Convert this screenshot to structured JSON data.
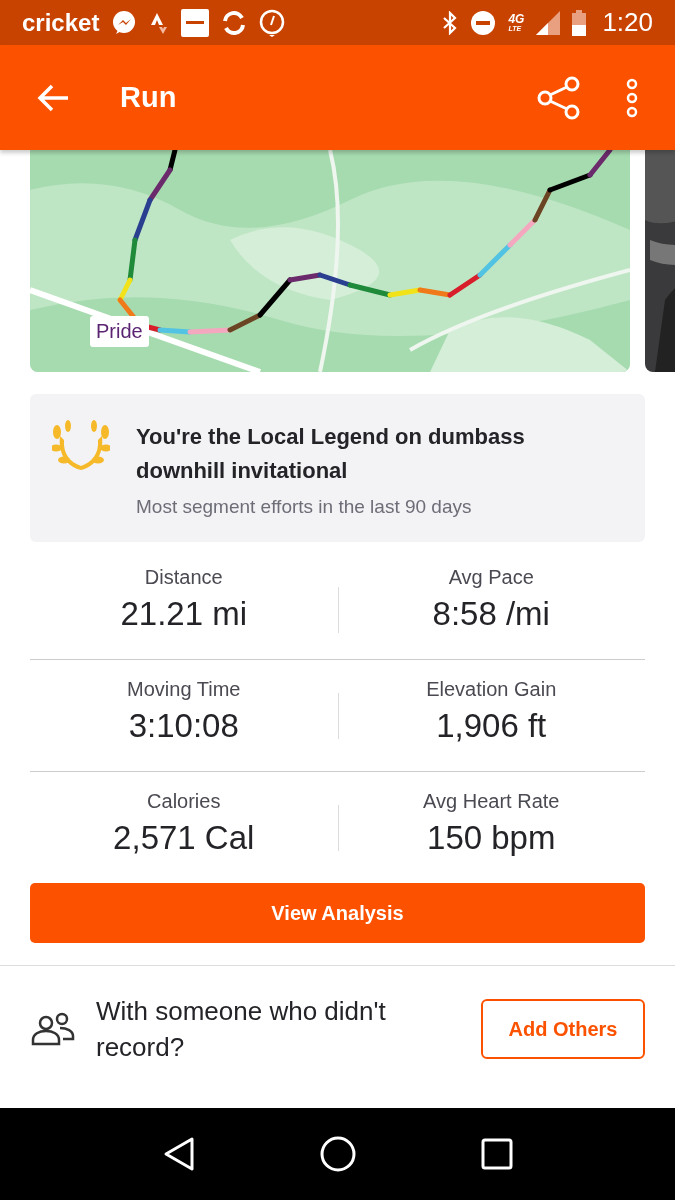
{
  "status_bar": {
    "carrier": "cricket",
    "network": "4G",
    "network_sub": "LTE",
    "time": "1:20"
  },
  "app_bar": {
    "title": "Run"
  },
  "map": {
    "badge": "Pride"
  },
  "local_legend": {
    "title": "You're the Local Legend on dumbass downhill invitational",
    "subtitle": "Most segment efforts in the last 90 days"
  },
  "stats": [
    {
      "label": "Distance",
      "value": "21.21 mi"
    },
    {
      "label": "Avg Pace",
      "value": "8:58 /mi"
    },
    {
      "label": "Moving Time",
      "value": "3:10:08"
    },
    {
      "label": "Elevation Gain",
      "value": "1,906 ft"
    },
    {
      "label": "Calories",
      "value": "2,571 Cal"
    },
    {
      "label": "Avg Heart Rate",
      "value": "150 bpm"
    }
  ],
  "analysis_button": "View Analysis",
  "add_others": {
    "prompt": "With someone who didn't record?",
    "button": "Add Others"
  }
}
